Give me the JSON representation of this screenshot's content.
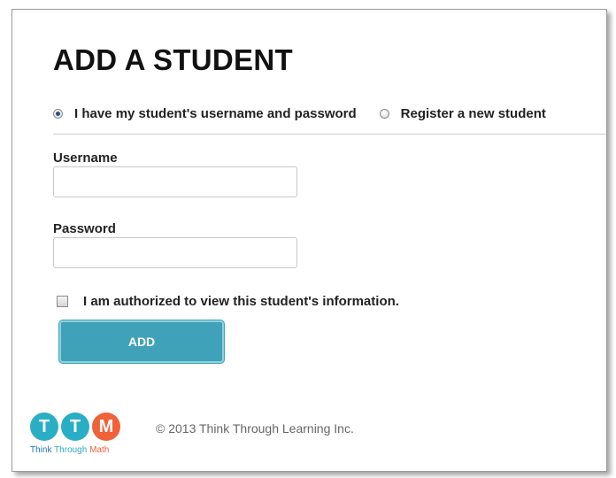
{
  "page": {
    "title": "ADD A STUDENT"
  },
  "mode_options": [
    {
      "label": "I have my student's username and password",
      "selected": true
    },
    {
      "label": "Register a new student",
      "selected": false
    }
  ],
  "form": {
    "username_label": "Username",
    "username_value": "",
    "password_label": "Password",
    "password_value": "",
    "authorize_label": "I am authorized to view this student's information.",
    "authorize_checked": false,
    "add_label": "ADD"
  },
  "footer": {
    "logo": {
      "letters": [
        "T",
        "T",
        "M"
      ],
      "word_think": "Think",
      "word_through": "Through",
      "word_math": "Math",
      "colors": {
        "teal": "#2aaec5",
        "orange": "#f0623a",
        "blue": "#2277b3"
      }
    },
    "copyright": "© 2013 Think Through Learning Inc."
  },
  "colors": {
    "button": "#3fa2b8",
    "button_border": "#8fd0de"
  }
}
